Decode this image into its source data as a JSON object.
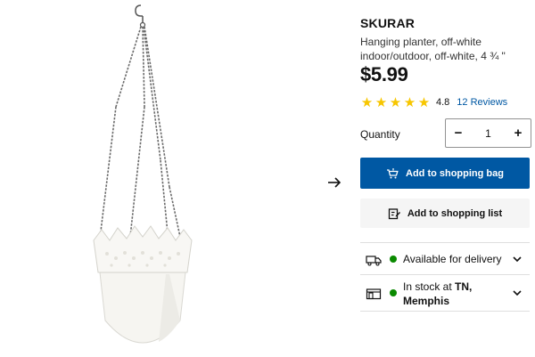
{
  "product": {
    "name": "SKURAR",
    "description": "Hanging planter, off-white indoor/outdoor, off-white, 4 ¾ \"",
    "price": "$5.99",
    "image_alt": "White hanging planter with chains"
  },
  "rating": {
    "stars": 5,
    "value": "4.8",
    "reviews_label": "12 Reviews"
  },
  "quantity": {
    "label": "Quantity",
    "value": "1",
    "minus_symbol": "−",
    "plus_symbol": "+"
  },
  "actions": {
    "add_to_bag_label": "Add to shopping bag",
    "add_to_list_label": "Add to shopping list"
  },
  "availability": {
    "delivery_label": "Available for delivery",
    "stock_prefix": "In stock at ",
    "stock_location": "TN, Memphis"
  },
  "colors": {
    "primary_blue": "#0058a3",
    "star_yellow": "#f7c600",
    "status_green": "#0a8a00"
  },
  "icons": {
    "next": "arrow-right-icon",
    "cart": "cart-icon",
    "list": "edit-list-icon",
    "delivery": "truck-icon",
    "store": "store-icon",
    "expand": "chevron-down-icon"
  }
}
